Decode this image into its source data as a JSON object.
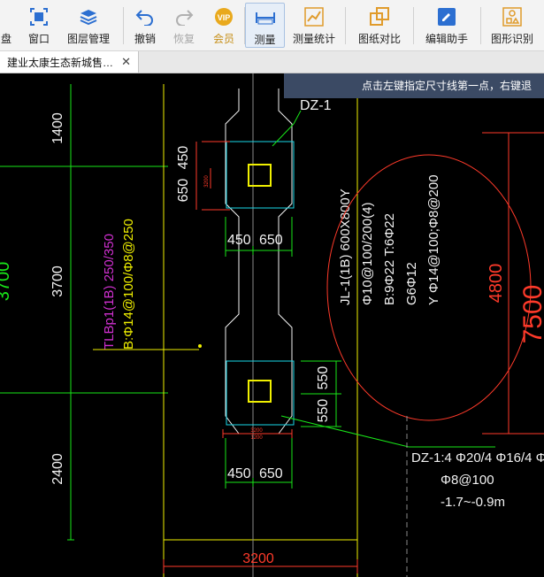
{
  "toolbar": {
    "items": [
      {
        "id": "disk",
        "label": "盘"
      },
      {
        "id": "window",
        "label": "窗口"
      },
      {
        "id": "layers",
        "label": "图层管理"
      },
      {
        "id": "undo",
        "label": "撤销"
      },
      {
        "id": "redo",
        "label": "恢复"
      },
      {
        "id": "vip",
        "label": "会员",
        "badge": "VIP"
      },
      {
        "id": "measure",
        "label": "测量"
      },
      {
        "id": "measure-stats",
        "label": "测量统计"
      },
      {
        "id": "compare",
        "label": "图纸对比"
      },
      {
        "id": "edit-helper",
        "label": "编辑助手"
      },
      {
        "id": "shape-recog",
        "label": "图形识别"
      }
    ]
  },
  "tab": {
    "title": "建业太康生态新城售…",
    "close": "✕"
  },
  "hint": "点击左键指定尺寸线第一点，右键退",
  "drawing": {
    "dz_top_label": "DZ-1",
    "beam_lines": [
      "JL-1(1B) 600X800Y",
      "Φ10@100/200(4)",
      "B:9Φ22 T:6Φ22",
      "G6Φ12",
      "Y Φ14@100;Φ8@200"
    ],
    "tl_lines": [
      "TLBp1(1B) 250/350",
      "B:Φ14@100/Φ8@250"
    ],
    "dz_bottom_lines": [
      "DZ-1:4 Φ20/4 Φ16/4 Φ",
      "Φ8@100",
      "-1.7~-0.9m"
    ],
    "dims": {
      "left_3700": "3700",
      "d1400": "1400",
      "d3700": "3700",
      "d2400": "2400",
      "d650": "650",
      "d450": "450",
      "d450b": "450",
      "d650b": "650",
      "d550a": "550",
      "d550b": "550",
      "d450c": "450",
      "d650c": "650",
      "d3200": "3200",
      "d4800": "4800",
      "d7500": "7500",
      "s3200": "3200",
      "s1200": "1200"
    }
  },
  "colors": {
    "red": "#ff3a2a",
    "green": "#19e619",
    "yellow": "#f0f000",
    "cyan": "#19d8e8",
    "white": "#f2f2f2",
    "magenta": "#d030d0"
  }
}
